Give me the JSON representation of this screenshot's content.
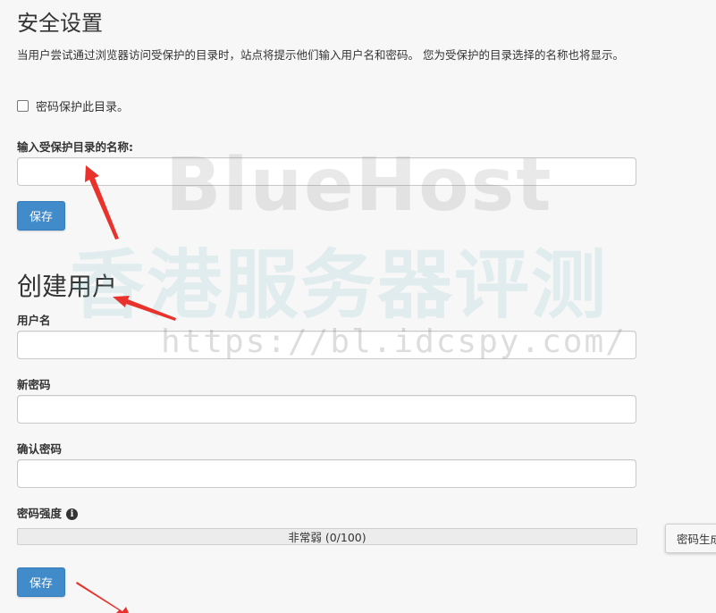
{
  "security": {
    "title": "安全设置",
    "description": "当用户尝试通过浏览器访问受保护的目录时，站点将提示他们输入用户名和密码。 您为受保护的目录选择的名称也将显示。",
    "checkbox_label": "密码保护此目录。",
    "dir_name_label": "输入受保护目录的名称:",
    "dir_name_value": "",
    "save_label": "保存"
  },
  "create_user": {
    "title": "创建用户",
    "username_label": "用户名",
    "username_value": "",
    "new_password_label": "新密码",
    "new_password_value": "",
    "confirm_password_label": "确认密码",
    "confirm_password_value": "",
    "strength_label": "密码强度",
    "strength_text": "非常弱 (0/100)",
    "strength_value": 0,
    "generator_label": "密码生成器",
    "save_label": "保存"
  },
  "watermark": {
    "line1": "BlueHost",
    "line2": "香港服务器评测",
    "line3": "https://bl.idcspy.com/"
  },
  "colors": {
    "primary_button": "#428bca",
    "annotation_arrow": "#e8322b"
  }
}
